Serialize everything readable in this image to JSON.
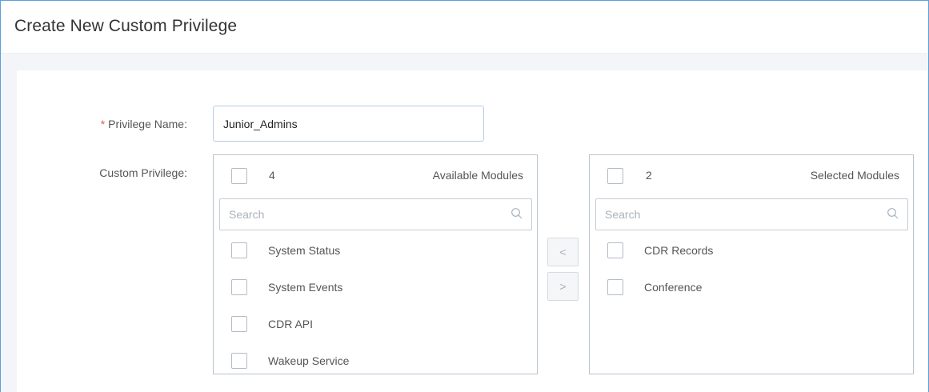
{
  "header": {
    "title": "Create New Custom Privilege"
  },
  "form": {
    "required_marker": "*",
    "privilege_name_label": "Privilege Name:",
    "privilege_name_value": "Junior_Admins",
    "custom_privilege_label": "Custom Privilege:"
  },
  "available": {
    "count": "4",
    "title": "Available Modules",
    "search_placeholder": "Search",
    "items": [
      "System Status",
      "System Events",
      "CDR API",
      "Wakeup Service"
    ]
  },
  "selected": {
    "count": "2",
    "title": "Selected Modules",
    "search_placeholder": "Search",
    "items": [
      "CDR Records",
      "Conference"
    ]
  },
  "transfer": {
    "move_left": "<",
    "move_right": ">"
  },
  "icons": {
    "search": "search-icon"
  },
  "colors": {
    "required": "#e55b4d",
    "input_border": "#b8cde6",
    "frame_border": "#5aa0dd"
  }
}
